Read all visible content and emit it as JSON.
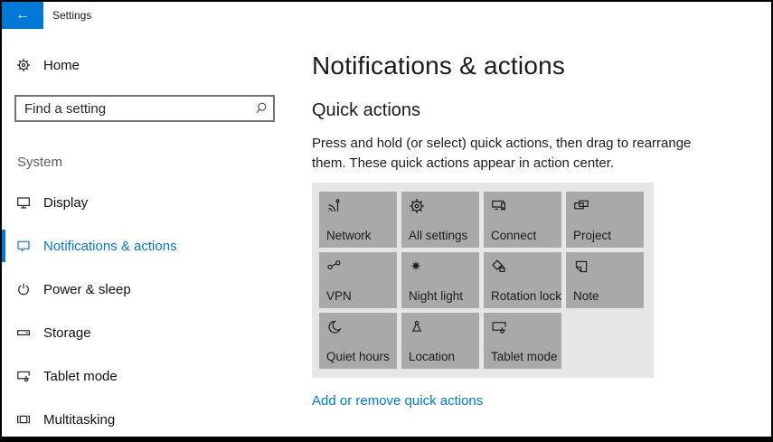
{
  "window": {
    "title": "Settings",
    "back_glyph": "←"
  },
  "colors": {
    "accent": "#0078d7",
    "panel_background": "#e6e6e6",
    "tile_background": "#a9a9a9",
    "link": "#0078d7"
  },
  "sidebar": {
    "home": {
      "label": "Home",
      "icon": "gear-icon"
    },
    "search": {
      "placeholder": "Find a setting",
      "icon": "search-icon"
    },
    "section_label": "System",
    "items": [
      {
        "label": "Display",
        "icon": "display-icon",
        "selected": false
      },
      {
        "label": "Notifications & actions",
        "icon": "notifications-icon",
        "selected": true
      },
      {
        "label": "Power & sleep",
        "icon": "power-icon",
        "selected": false
      },
      {
        "label": "Storage",
        "icon": "storage-icon",
        "selected": false
      },
      {
        "label": "Tablet mode",
        "icon": "tablet-mode-icon",
        "selected": false
      },
      {
        "label": "Multitasking",
        "icon": "multitasking-icon",
        "selected": false
      }
    ]
  },
  "main": {
    "title": "Notifications & actions",
    "section_title": "Quick actions",
    "description": "Press and hold (or select) quick actions, then drag to rearrange them. These quick actions appear in action center.",
    "quick_actions": [
      {
        "label": "Network",
        "icon": "network-icon"
      },
      {
        "label": "All settings",
        "icon": "all-settings-icon"
      },
      {
        "label": "Connect",
        "icon": "connect-icon"
      },
      {
        "label": "Project",
        "icon": "project-icon"
      },
      {
        "label": "VPN",
        "icon": "vpn-icon"
      },
      {
        "label": "Night light",
        "icon": "night-light-icon"
      },
      {
        "label": "Rotation lock",
        "icon": "rotation-lock-icon"
      },
      {
        "label": "Note",
        "icon": "note-icon"
      },
      {
        "label": "Quiet hours",
        "icon": "quiet-hours-icon"
      },
      {
        "label": "Location",
        "icon": "location-icon"
      },
      {
        "label": "Tablet mode",
        "icon": "tablet-mode-icon"
      }
    ],
    "link_label": "Add or remove quick actions"
  }
}
